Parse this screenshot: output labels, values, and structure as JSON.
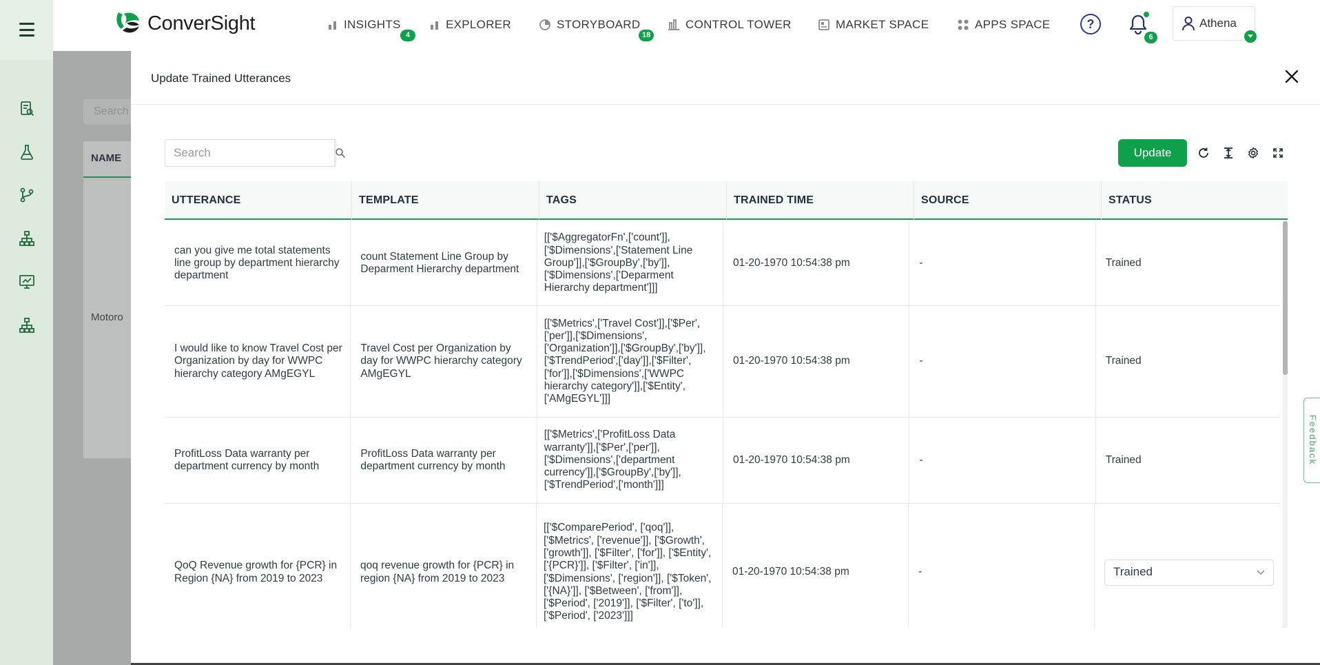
{
  "brand": {
    "name": "ConverSight",
    "accent": "#0fa14a"
  },
  "nav": {
    "items": [
      {
        "label": "INSIGHTS",
        "badge": "4",
        "icon": "bar-chart-icon"
      },
      {
        "label": "EXPLORER",
        "badge": "",
        "icon": "bar-chart-icon"
      },
      {
        "label": "STORYBOARD",
        "badge": "18",
        "icon": "pie-chart-icon"
      },
      {
        "label": "CONTROL TOWER",
        "badge": "",
        "icon": "tower-icon"
      },
      {
        "label": "MARKET SPACE",
        "badge": "",
        "icon": "market-icon"
      },
      {
        "label": "APPS SPACE",
        "badge": "",
        "icon": "apps-icon"
      }
    ],
    "help_label": "?",
    "notifications_count": "6",
    "user_name": "Athena"
  },
  "sidebar": {
    "icons": [
      "report-icon",
      "flask-icon",
      "branch-icon",
      "hierarchy-icon",
      "presentation-icon",
      "hierarchy-icon"
    ]
  },
  "background": {
    "search_placeholder": "Search",
    "column_name": "NAME",
    "cell_text": "Motoro"
  },
  "modal": {
    "title": "Update Trained Utterances",
    "search_placeholder": "Search",
    "update_label": "Update",
    "feedback_label": "Feedback"
  },
  "table": {
    "columns": [
      "UTTERANCE",
      "TEMPLATE",
      "TAGS",
      "TRAINED TIME",
      "SOURCE",
      "STATUS"
    ],
    "rows": [
      {
        "utterance": "can you give me total statements line group by department hierarchy department",
        "template": "count Statement Line Group by Deparment Hierarchy department",
        "tags": "[['$AggregatorFn',['count']],['$Dimensions',['Statement Line Group']],['$GroupBy',['by']],['$Dimensions',['Deparment Hierarchy department']]]",
        "trained_time": "01-20-1970 10:54:38 pm",
        "source": "-",
        "status": "Trained"
      },
      {
        "utterance": "I would like to know Travel Cost per Organization by day for WWPC hierarchy category AMgEGYL",
        "template": "Travel Cost per Organization by day for WWPC hierarchy category AMgEGYL",
        "tags": "[['$Metrics',['Travel Cost']],['$Per',['per']],['$Dimensions',['Organization']],['$GroupBy',['by']],['$TrendPeriod',['day']],['$Filter',['for']],['$Dimensions',['WWPC hierarchy category']],['$Entity',['AMgEGYL']]]",
        "trained_time": "01-20-1970 10:54:38 pm",
        "source": "-",
        "status": "Trained"
      },
      {
        "utterance": "ProfitLoss Data warranty per department currency by month",
        "template": "ProfitLoss Data warranty per department currency by month",
        "tags": "[['$Metrics',['ProfitLoss Data warranty']],['$Per',['per']],['$Dimensions',['department currency']],['$GroupBy',['by']],['$TrendPeriod',['month']]]",
        "trained_time": "01-20-1970 10:54:38 pm",
        "source": "-",
        "status": "Trained"
      },
      {
        "utterance": "QoQ Revenue growth for {PCR} in Region {NA} from 2019 to 2023",
        "template": "qoq revenue growth for {PCR} in region {NA} from 2019 to 2023",
        "tags": "[['$ComparePeriod', ['qoq']], ['$Metrics', ['revenue']], ['$Growth', ['growth']], ['$Filter', ['for']], ['$Entity', ['{PCR}']], ['$Filter', ['in']], ['$Dimensions', ['region']], ['$Token', ['{NA}']], ['$Between', ['from']], ['$Period', ['2019']], ['$Filter', ['to']], ['$Period', ['2023']]]",
        "trained_time": "01-20-1970 10:54:38 pm",
        "source": "-",
        "status": "Trained"
      }
    ]
  }
}
